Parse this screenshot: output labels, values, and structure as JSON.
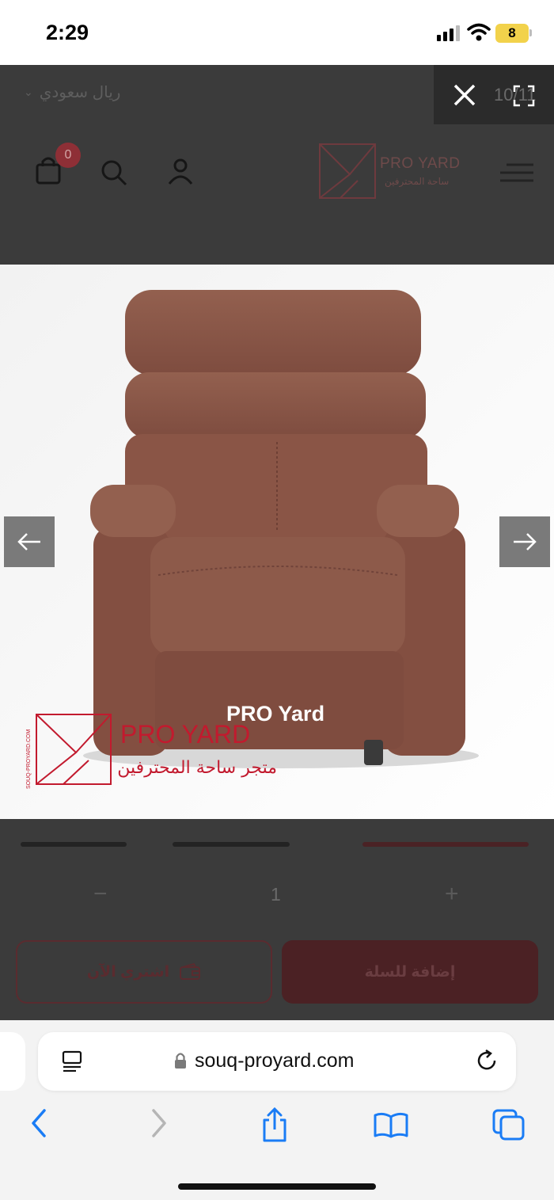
{
  "status_bar": {
    "time": "2:29",
    "battery": "8"
  },
  "header": {
    "currency": "ريال سعودي",
    "logo_name": "PRO YARD",
    "logo_tagline": "ساحة المحترفين",
    "cart_count": "0"
  },
  "lightbox": {
    "counter": "10/11",
    "product_label": "PRO Yard",
    "watermark_name": "PRO YARD",
    "watermark_tagline": "متجر ساحة المحترفين",
    "watermark_side_text": "SOUQ-PROYARD.COM"
  },
  "product": {
    "quantity": "1",
    "minus": "−",
    "plus": "+",
    "buy_now_label": "اشتري الآن",
    "add_to_cart_label": "إضافة للسلة"
  },
  "safari": {
    "url": "souq-proyard.com"
  },
  "colors": {
    "brand": "#8e2f36",
    "chair": "#8a5546",
    "dim": "#3b3b3b",
    "ios_blue": "#1a7cf5"
  }
}
